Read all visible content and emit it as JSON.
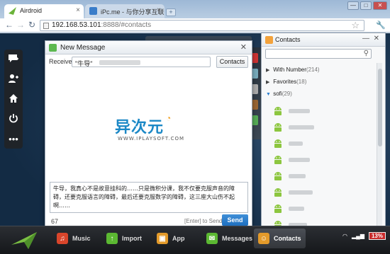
{
  "browser": {
    "tabs": [
      {
        "label": "Airdroid",
        "active": true
      },
      {
        "label": "iPc.me - 与你分享互联网的",
        "active": false
      }
    ],
    "new_tab_label": "+",
    "window_buttons": [
      "—",
      "□",
      "✕"
    ],
    "url_host": "192.168.53.101",
    "url_rest": ":8888/#contacts"
  },
  "sidebar": {
    "items": [
      "message-plus-icon",
      "add-contact-icon",
      "home-icon",
      "power-icon",
      "more-icon"
    ]
  },
  "dialog": {
    "title": "New Message",
    "receiver_label": "Receiver:",
    "receiver_chip": "\"牛导\"",
    "contacts_button": "Contacts",
    "logo_text": "异次元",
    "logo_subtext": "WWW.IPLAYSOFT.COM",
    "message": "牛导，我真心不是故意挂科的……只是微积分课，我不仅要克服声音的障碍，还要克服语言的障碍，最后还要克服数学的障碍，这三座大山伤不起啊……",
    "char_count": "67",
    "send_hint": "[Enter] to Send",
    "send_button": "Send"
  },
  "contacts_panel": {
    "title": "Contacts",
    "minimize": "—",
    "close": "✕",
    "search_placeholder": "",
    "groups": [
      {
        "name": "With Number",
        "count": "(214)",
        "expanded": false
      },
      {
        "name": "Favorites",
        "count": "(18)",
        "expanded": false
      },
      {
        "name": "sofi",
        "count": "(29)",
        "expanded": true
      }
    ]
  },
  "dock": {
    "items": [
      {
        "label": "Music",
        "icon": "music-icon",
        "color": "#d9452b"
      },
      {
        "label": "Import",
        "icon": "import-icon",
        "color": "#5bb832"
      },
      {
        "label": "App",
        "icon": "app-icon",
        "color": "#e39a2a"
      },
      {
        "label": "Messages",
        "icon": "messages-icon",
        "color": "#5bb832"
      },
      {
        "label": "Contacts",
        "icon": "contacts-icon",
        "color": "#e39a2a"
      }
    ],
    "battery": "13%"
  },
  "colors": {
    "accent": "#1e6fbf",
    "android_green": "#8cc63f",
    "dock_bg": "#1b1d21"
  }
}
